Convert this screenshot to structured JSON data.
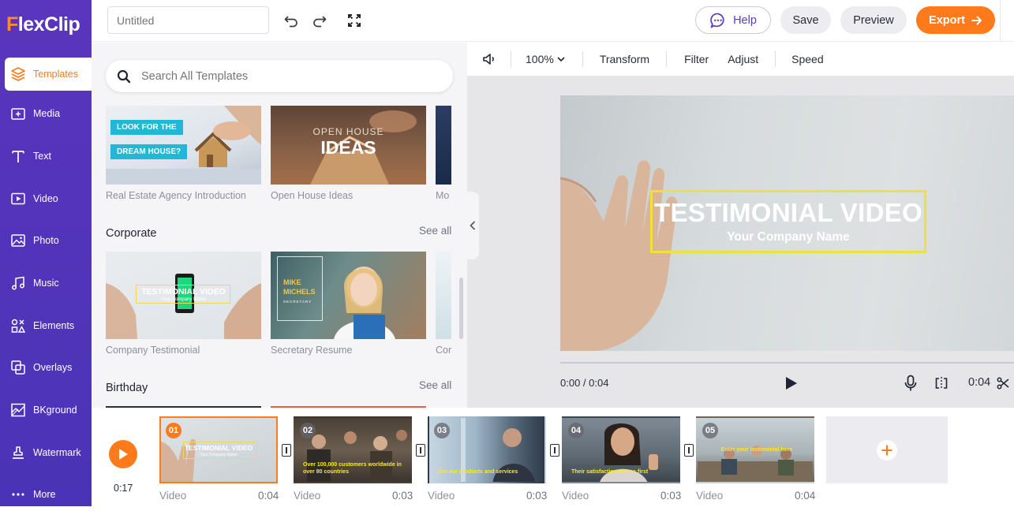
{
  "app": {
    "logo_f": "F",
    "logo_rest": "lexClip"
  },
  "sidebar": {
    "items": [
      {
        "label": "Templates",
        "icon": "layers-icon",
        "active": true
      },
      {
        "label": "Media",
        "icon": "media-plus-icon"
      },
      {
        "label": "Text",
        "icon": "text-icon"
      },
      {
        "label": "Video",
        "icon": "video-icon"
      },
      {
        "label": "Photo",
        "icon": "photo-icon"
      },
      {
        "label": "Music",
        "icon": "music-icon"
      },
      {
        "label": "Elements",
        "icon": "elements-icon"
      },
      {
        "label": "Overlays",
        "icon": "overlays-icon"
      },
      {
        "label": "BKground",
        "icon": "background-icon"
      },
      {
        "label": "Watermark",
        "icon": "watermark-icon"
      },
      {
        "label": "More",
        "icon": "more-icon"
      }
    ]
  },
  "topbar": {
    "project_title_placeholder": "Untitled",
    "help_label": "Help",
    "save_label": "Save",
    "preview_label": "Preview",
    "export_label": "Export"
  },
  "library": {
    "search_placeholder": "Search All Templates",
    "top_row": [
      {
        "caption": "Real Estate Agency Introduction",
        "text1": "LOOK FOR THE",
        "text2": "DREAM HOUSE?"
      },
      {
        "caption": "Open House Ideas",
        "text1": "OPEN HOUSE",
        "text2": "IDEAS"
      },
      {
        "caption": "Mo"
      }
    ],
    "sections": [
      {
        "title": "Corporate",
        "see_all": "See all",
        "items": [
          {
            "caption": "Company Testimonial",
            "text1": "TESTIMONIAL VIDEO",
            "text2": "Your Company Name"
          },
          {
            "caption": "Secretary Resume",
            "text1": "MIKE",
            "text2": "MICHELS",
            "text3": "SECRETARY"
          },
          {
            "caption": "Cor"
          }
        ]
      },
      {
        "title": "Birthday",
        "see_all": "See all"
      }
    ]
  },
  "editor": {
    "toolbar": {
      "zoom": "100%",
      "transform": "Transform",
      "filter": "Filter",
      "adjust": "Adjust",
      "speed": "Speed"
    },
    "canvas": {
      "title": "TESTIMONIAL VIDEO",
      "subtitle": "Your Company Name"
    },
    "current_time": "0:00 / 0:04",
    "duration": "0:04"
  },
  "timeline": {
    "total_time": "0:17",
    "clips": [
      {
        "num": "01",
        "type": "Video",
        "duration": "0:04",
        "t1": "TESTIMONIAL VIDEO",
        "t2": "Your Company Name",
        "selected": true
      },
      {
        "num": "02",
        "type": "Video",
        "duration": "0:03",
        "caption": "Over 100,000 customers worldwide in over 80 countries"
      },
      {
        "num": "03",
        "type": "Video",
        "duration": "0:03",
        "caption": "Use our products and services"
      },
      {
        "num": "04",
        "type": "Video",
        "duration": "0:03",
        "caption": "Their satisfaction comes first"
      },
      {
        "num": "05",
        "type": "Video",
        "duration": "0:04",
        "caption": "Enter your testimonial here"
      }
    ]
  },
  "colors": {
    "accent": "#ff7a1a",
    "sidebar": "#5235bb",
    "title_frame": "#f4de3a",
    "help_text": "#5a3cbf"
  }
}
